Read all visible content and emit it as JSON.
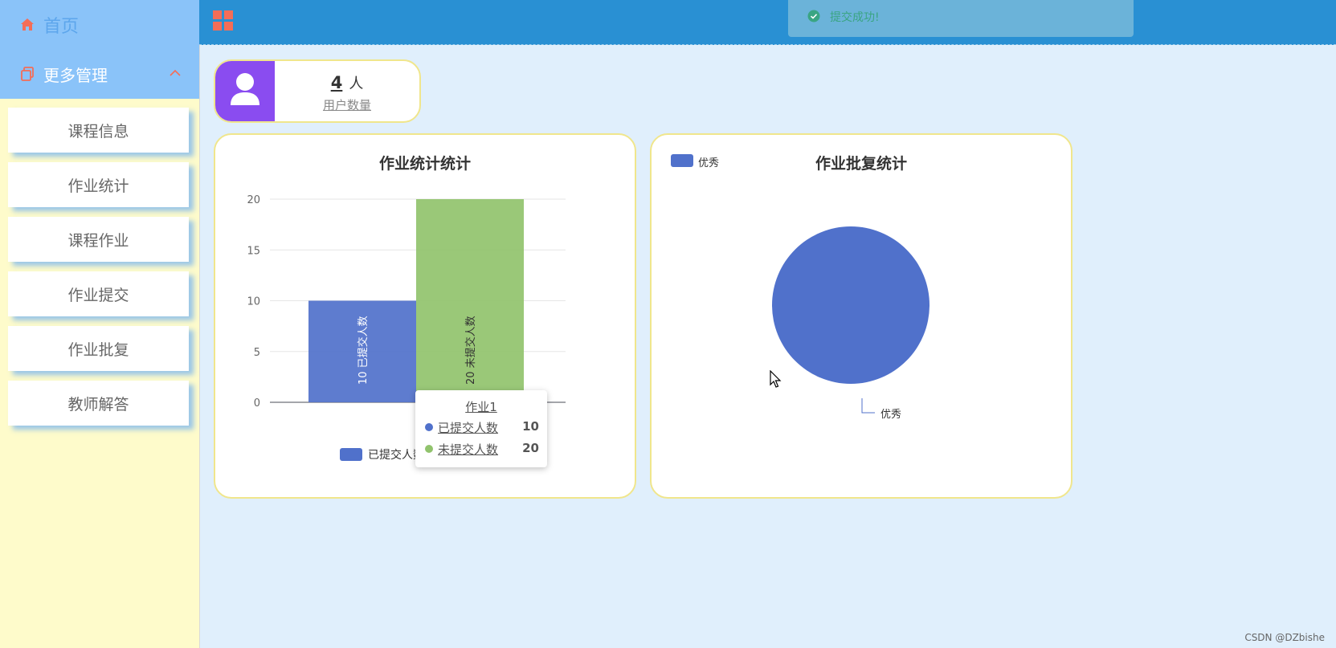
{
  "sidebar": {
    "home_label": "首页",
    "more_label": "更多管理",
    "items": [
      "课程信息",
      "作业统计",
      "课程作业",
      "作业提交",
      "作业批复",
      "教师解答"
    ]
  },
  "header": {
    "toast_text": "提交成功!"
  },
  "user_card": {
    "count": "4",
    "unit": "人",
    "label": "用户数量"
  },
  "bar_chart": {
    "title": "作业统计统计",
    "legend_submitted": "已提交人数",
    "tooltip": {
      "title": "作业1",
      "rows": [
        {
          "name": "已提交人数",
          "value": "10",
          "color": "#5071cb"
        },
        {
          "name": "未提交人数",
          "value": "20",
          "color": "#91c36d"
        }
      ]
    }
  },
  "pie_chart": {
    "title": "作业批复统计",
    "legend": "优秀",
    "slice_label": "优秀"
  },
  "chart_data": [
    {
      "type": "bar",
      "title": "作业统计统计",
      "categories": [
        "作业1"
      ],
      "series": [
        {
          "name": "已提交人数",
          "values": [
            10
          ],
          "color": "#5071cb"
        },
        {
          "name": "未提交人数",
          "values": [
            20
          ],
          "color": "#91c36d"
        }
      ],
      "ylim": [
        0,
        20
      ],
      "yticks": [
        0,
        5,
        10,
        15,
        20
      ],
      "grid": true,
      "legend": "bottom"
    },
    {
      "type": "pie",
      "title": "作业批复统计",
      "categories": [
        "优秀"
      ],
      "values": [
        1
      ],
      "colors": [
        "#5071cb"
      ],
      "legend": "top-left"
    }
  ],
  "watermark": "CSDN @DZbishe",
  "colors": {
    "sidebar_bg": "#fefbcb",
    "nav_bg": "#8ac3f9",
    "header_bg": "#2990d3",
    "page_bg": "#e0effc",
    "avatar_bg": "#8a4cf0",
    "card_border": "#f0e68c",
    "icon_accent": "#f46d57"
  },
  "icons": {
    "home": "home-icon",
    "more": "copy-icon",
    "chevron": "chevron-up-icon",
    "header": "grid-icon",
    "toast": "check-circle-icon",
    "user": "user-icon"
  }
}
